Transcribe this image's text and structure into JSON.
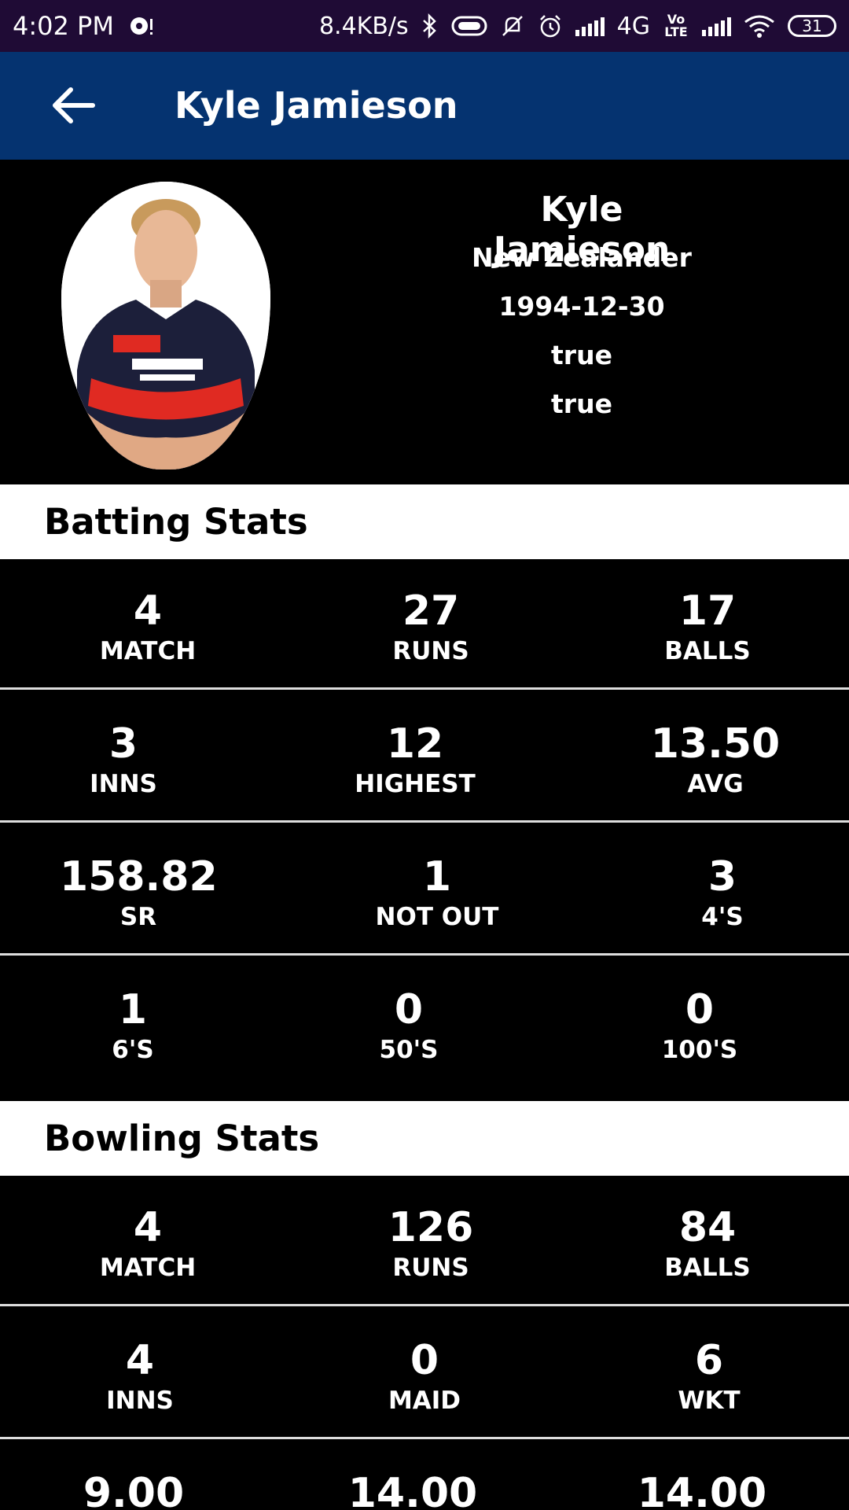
{
  "status_bar": {
    "time": "4:02 PM",
    "speed": "8.4KB/s",
    "network": "4G",
    "volte": "Vo LTE",
    "battery": "31"
  },
  "app_bar": {
    "title": "Kyle Jamieson"
  },
  "profile": {
    "name": "Kyle Jamieson",
    "nationality": "New Zealander",
    "dob": "1994-12-30",
    "field_a": "true",
    "field_b": "true"
  },
  "batting": {
    "title": "Batting Stats",
    "rows": [
      [
        {
          "value": "4",
          "label": "MATCH"
        },
        {
          "value": "27",
          "label": "RUNS"
        },
        {
          "value": "17",
          "label": "BALLS"
        }
      ],
      [
        {
          "value": "3",
          "label": "INNS"
        },
        {
          "value": "12",
          "label": "HIGHEST"
        },
        {
          "value": "13.50",
          "label": "AVG"
        }
      ],
      [
        {
          "value": "158.82",
          "label": "SR"
        },
        {
          "value": "1",
          "label": "NOT OUT"
        },
        {
          "value": "3",
          "label": "4'S"
        }
      ],
      [
        {
          "value": "1",
          "label": "6'S"
        },
        {
          "value": "0",
          "label": "50'S"
        },
        {
          "value": "0",
          "label": "100'S"
        }
      ]
    ]
  },
  "bowling": {
    "title": "Bowling Stats",
    "rows": [
      [
        {
          "value": "4",
          "label": "MATCH"
        },
        {
          "value": "126",
          "label": "RUNS"
        },
        {
          "value": "84",
          "label": "BALLS"
        }
      ],
      [
        {
          "value": "4",
          "label": "INNS"
        },
        {
          "value": "0",
          "label": "MAID"
        },
        {
          "value": "6",
          "label": "WKT"
        }
      ],
      [
        {
          "value": "9.00",
          "label": ""
        },
        {
          "value": "14.00",
          "label": ""
        },
        {
          "value": "14.00",
          "label": ""
        }
      ]
    ]
  }
}
